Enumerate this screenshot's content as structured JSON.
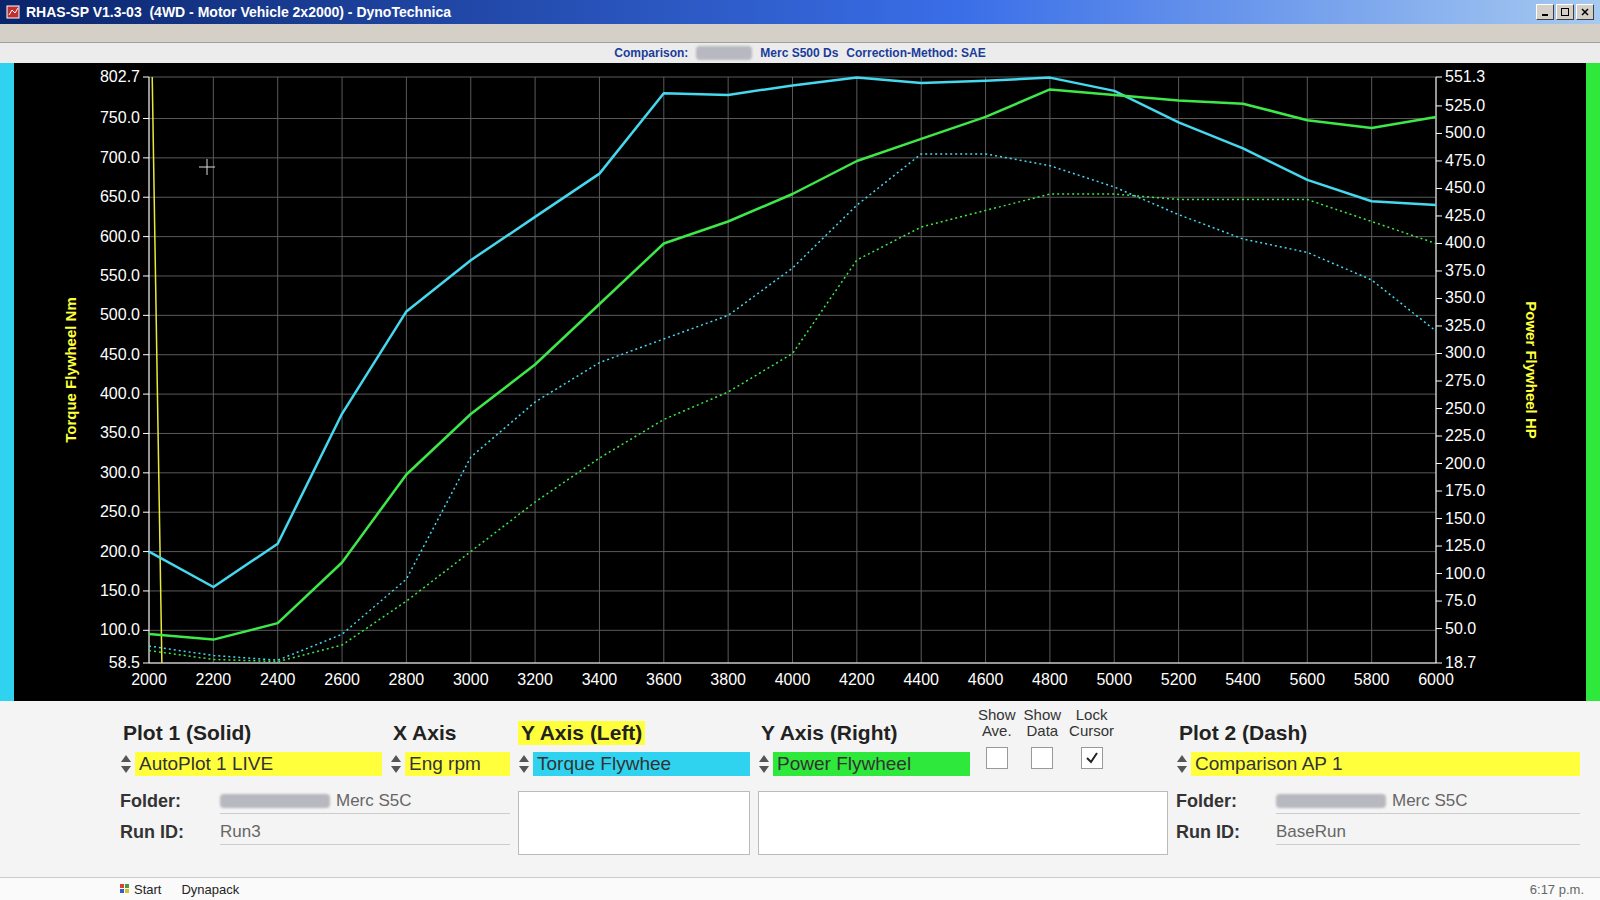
{
  "window": {
    "title": "RHAS-SP V1.3-03  (4WD - Motor Vehicle 2x2000) - DynoTechnica"
  },
  "header": {
    "comparison_label": "Comparison:",
    "comparison_value": "Merc S500 Ds",
    "correction": "Correction-Method: SAE"
  },
  "chart": {
    "x_axis": {
      "min": 2000,
      "max": 6000,
      "ticks": [
        "2000",
        "2200",
        "2400",
        "2600",
        "2800",
        "3000",
        "3200",
        "3400",
        "3600",
        "3800",
        "4000",
        "4200",
        "4400",
        "4600",
        "4800",
        "5000",
        "5200",
        "5400",
        "5600",
        "5800",
        "6000"
      ]
    },
    "y_left": {
      "title": "Torque Flywheel Nm",
      "min": 58.5,
      "max": 802.7,
      "ticks": [
        "802.7",
        "750.0",
        "700.0",
        "650.0",
        "600.0",
        "550.0",
        "500.0",
        "450.0",
        "400.0",
        "350.0",
        "300.0",
        "250.0",
        "200.0",
        "150.0",
        "100.0",
        "58.5"
      ]
    },
    "y_right": {
      "title": "Power Flywheel HP",
      "min": 18.7,
      "max": 551.3,
      "ticks": [
        "551.3",
        "525.0",
        "500.0",
        "475.0",
        "450.0",
        "425.0",
        "400.0",
        "375.0",
        "350.0",
        "325.0",
        "300.0",
        "275.0",
        "250.0",
        "225.0",
        "200.0",
        "175.0",
        "150.0",
        "125.0",
        "100.0",
        "75.0",
        "50.0",
        "18.7"
      ]
    },
    "x_values": [
      2000,
      2200,
      2400,
      2600,
      2800,
      3000,
      3200,
      3400,
      3600,
      3800,
      4000,
      4200,
      4400,
      4600,
      4800,
      5000,
      5200,
      5400,
      5600,
      5800,
      6000
    ],
    "series": [
      {
        "axis": "left",
        "kind": "solid",
        "color": "#45d8ee",
        "values": [
          200,
          155,
          210,
          375,
          505,
          570,
          625,
          680,
          782,
          780,
          792,
          802,
          795,
          798,
          802,
          785,
          745,
          712,
          672,
          645,
          640
        ]
      },
      {
        "axis": "right",
        "kind": "solid",
        "color": "#3ee84a",
        "values": [
          45,
          40,
          55,
          110,
          190,
          245,
          290,
          345,
          400,
          420,
          445,
          475,
          495,
          515,
          540,
          535,
          530,
          527,
          512,
          505,
          515
        ]
      },
      {
        "axis": "left",
        "kind": "dash",
        "color": "#45d8ee",
        "values": [
          80,
          68,
          62,
          95,
          165,
          320,
          390,
          440,
          470,
          500,
          560,
          640,
          705,
          705,
          690,
          663,
          628,
          597,
          580,
          545,
          480
        ]
      },
      {
        "axis": "right",
        "kind": "dash",
        "color": "#3ee84a",
        "values": [
          30,
          22,
          20,
          35,
          75,
          120,
          165,
          205,
          240,
          265,
          300,
          385,
          415,
          430,
          445,
          445,
          440,
          440,
          440,
          420,
          400
        ]
      }
    ]
  },
  "panel": {
    "plot1": {
      "title": "Plot 1 (Solid)",
      "value": "AutoPlot 1 LIVE",
      "color": "#ffff3c",
      "folder_label": "Folder:",
      "folder": "Merc S5C",
      "run_label": "Run ID:",
      "run": "Run3"
    },
    "x_axis": {
      "title": "X Axis",
      "value": "Eng rpm",
      "color": "#ffff3c"
    },
    "y_left": {
      "title": "Y Axis (Left)",
      "value": "Torque Flywhee",
      "color": "#2fd3f0"
    },
    "y_right": {
      "title": "Y Axis (Right)",
      "value": "Power Flywheel",
      "color": "#2ee83c"
    },
    "options": [
      {
        "top": "Show",
        "bottom": "Ave.",
        "checked": false
      },
      {
        "top": "Show",
        "bottom": "Data",
        "checked": false
      },
      {
        "top": "Lock",
        "bottom": "Cursor",
        "checked": true
      }
    ],
    "plot2": {
      "title": "Plot 2 (Dash)",
      "value": "Comparison AP 1",
      "color": "#ffff3c",
      "folder_label": "Folder:",
      "folder": "Merc S5C",
      "run_label": "Run ID:",
      "run": "BaseRun"
    }
  },
  "taskbar": {
    "start": "Start",
    "item": "Dynapack",
    "time": "6:17 p.m."
  }
}
